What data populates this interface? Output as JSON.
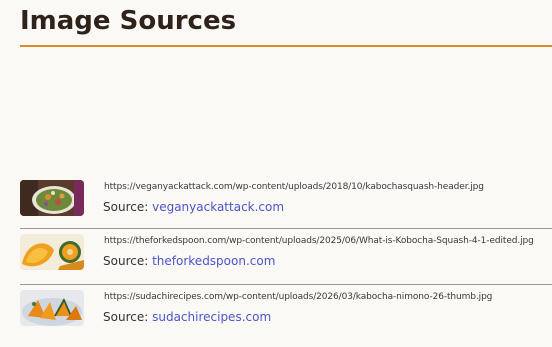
{
  "page": {
    "title": "Image Sources"
  },
  "sources": [
    {
      "url": "https://veganyackattack.com/wp-content/uploads/2018/10/kabochasquash-header.jpg",
      "source_label": "Source:",
      "source_link": "veganyackattack.com",
      "thumb": "salad-bowl-photo"
    },
    {
      "url": "https://theforkedspoon.com/wp-content/uploads/2025/06/What-is-Kobocha-Squash-4-1-edited.jpg",
      "source_label": "Source:",
      "source_link": "theforkedspoon.com",
      "thumb": "cut-squash-photo"
    },
    {
      "url": "https://sudachirecipes.com/wp-content/uploads/2026/03/kabocha-nimono-26-thumb.jpg",
      "source_label": "Source:",
      "source_link": "sudachirecipes.com",
      "thumb": "simmered-squash-photo"
    }
  ],
  "colors": {
    "accent": "#dd8a2a",
    "link": "#4b55c8",
    "title": "#2f221a",
    "background": "#fbf9f5"
  }
}
